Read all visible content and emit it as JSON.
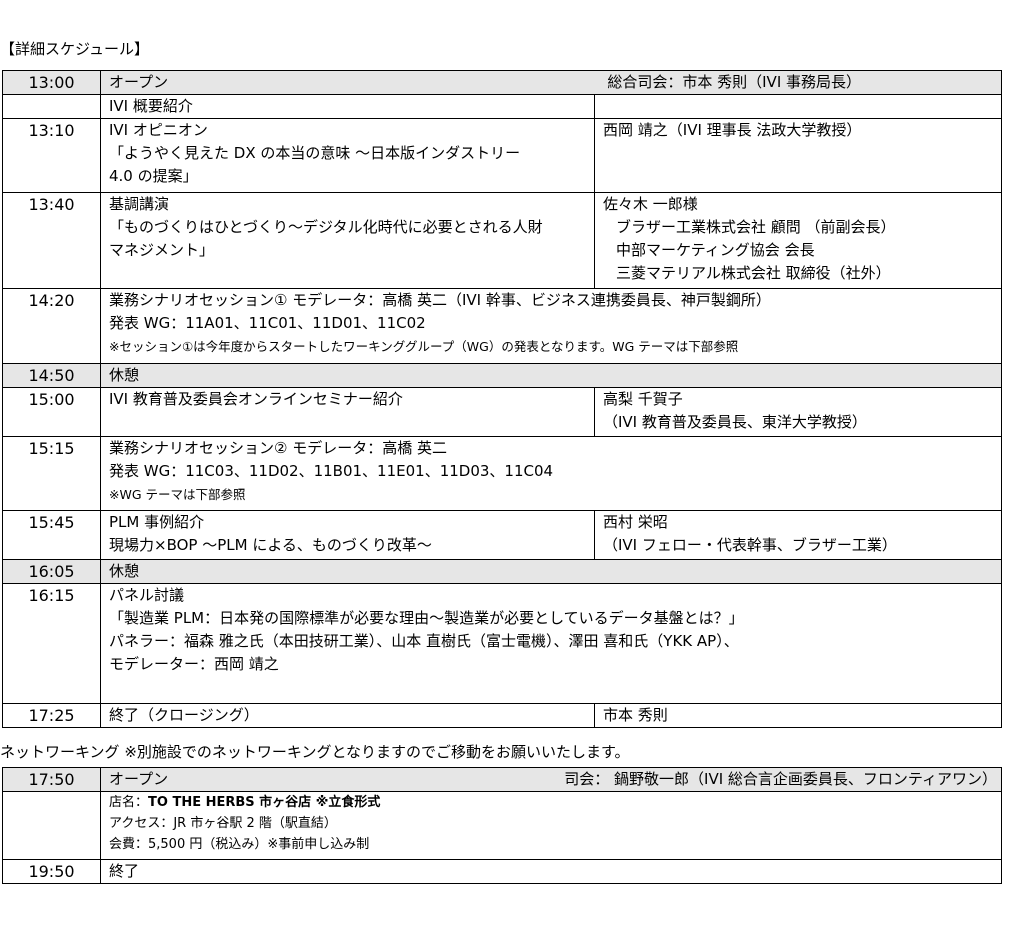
{
  "section_title": "【詳細スケジュール】",
  "schedule": {
    "opening": {
      "time": "13:00",
      "label": "オープン",
      "mc": "総合司会：市本 秀則（IVI 事務局長）"
    },
    "intro": {
      "label": "IVI 概要紹介"
    },
    "opinion": {
      "time": "13:10",
      "title": "IVI オピニオン",
      "line1": "「ようやく見えた DX の本当の意味 〜日本版インダストリー",
      "line2": "4.0 の提案」",
      "speaker": "西岡 靖之（IVI 理事長 法政大学教授）"
    },
    "keynote": {
      "time": "13:40",
      "title": "基調講演",
      "line1": "「ものづくりはひとづくり〜デジタル化時代に必要とされる人財",
      "line2": "マネジメント」",
      "speaker": "佐々木 一郎様",
      "aff1": "ブラザー工業株式会社 顧問 （前副会長）",
      "aff2": "中部マーケティング協会 会長",
      "aff3": "三菱マテリアル株式会社 取締役（社外）"
    },
    "session1": {
      "time": "14:20",
      "line1": "業務シナリオセッション① モデレータ：高橋 英二（IVI 幹事、ビジネス連携委員長、神戸製鋼所）",
      "line2": "発表 WG：11A01、11C01、11D01、11C02",
      "note": "※セッション①は今年度からスタートしたワーキンググループ（WG）の発表となります。WG テーマは下部参照"
    },
    "break1": {
      "time": "14:50",
      "label": "休憩"
    },
    "education": {
      "time": "15:00",
      "title": "IVI 教育普及委員会オンラインセミナー紹介",
      "speaker": "高梨 千賀子",
      "aff": "（IVI 教育普及委員長、東洋大学教授）"
    },
    "session2": {
      "time": "15:15",
      "line1": "業務シナリオセッション② モデレータ：高橋 英二",
      "line2": "発表 WG：11C03、11D02、11B01、11E01、11D03、11C04",
      "note": "※WG テーマは下部参照"
    },
    "plm": {
      "time": "15:45",
      "title": "PLM 事例紹介",
      "line2": "現場力×BOP 〜PLM による、ものづくり改革〜",
      "speaker": "西村 栄昭",
      "aff": "（IVI フェロー・代表幹事、ブラザー工業）"
    },
    "break2": {
      "time": "16:05",
      "label": "休憩"
    },
    "panel": {
      "time": "16:15",
      "title": "パネル討議",
      "line1": "「製造業 PLM：日本発の国際標準が必要な理由〜製造業が必要としているデータ基盤とは？」",
      "line2": "パネラー：福森 雅之氏（本田技研工業）、山本 直樹氏（富士電機）、澤田 喜和氏（YKK AP）、",
      "line3": "モデレーター：西岡 靖之"
    },
    "closing": {
      "time": "17:25",
      "label": "終了（クロージング）",
      "speaker": "市本 秀則"
    }
  },
  "networking_title": "ネットワーキング ※別施設でのネットワーキングとなりますのでご移動をお願いいたします。",
  "networking": {
    "open": {
      "time": "17:50",
      "label": "オープン",
      "mc": "司会： 鍋野敬一郎（IVI 総合言企画委員長、フロンティアワン）"
    },
    "venue_label": "店名：",
    "venue_name": "TO THE HERBS 市ヶ谷店 ※立食形式",
    "access": "アクセス：JR 市ヶ谷駅 2 階（駅直結）",
    "fee": "会費：5,500 円（税込み）※事前申し込み制",
    "end": {
      "time": "19:50",
      "label": "終了"
    }
  }
}
